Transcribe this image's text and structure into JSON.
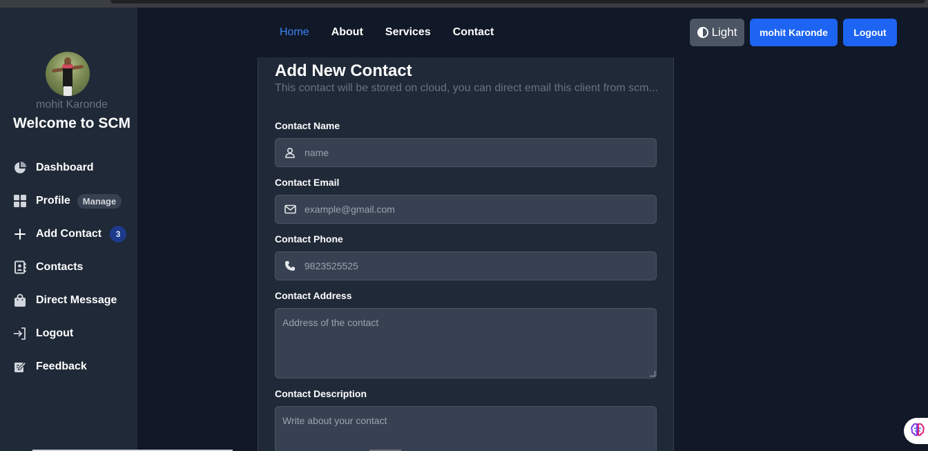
{
  "sidebar": {
    "username": "mohit Karonde",
    "welcome": "Welcome to SCM",
    "items": [
      {
        "label": "Dashboard",
        "icon": "pie-chart-icon"
      },
      {
        "label": "Profile",
        "icon": "grid-icon",
        "badge": "Manage"
      },
      {
        "label": "Add Contact",
        "icon": "plus-icon",
        "badge": "3"
      },
      {
        "label": "Contacts",
        "icon": "contact-book-icon"
      },
      {
        "label": "Direct Message",
        "icon": "shopping-bag-icon"
      },
      {
        "label": "Logout",
        "icon": "logout-icon"
      },
      {
        "label": "Feedback",
        "icon": "edit-icon"
      }
    ]
  },
  "topnav": {
    "links": [
      "Home",
      "About",
      "Services",
      "Contact"
    ],
    "active": "Home",
    "theme_label": "Light",
    "user_button": "mohit Karonde",
    "logout_button": "Logout"
  },
  "form": {
    "title": "Add New Contact",
    "subtitle": "This contact will be stored on cloud, you can direct email this client from scm...",
    "name_label": "Contact Name",
    "name_placeholder": "name",
    "email_label": "Contact Email",
    "email_placeholder": "example@gmail.com",
    "phone_label": "Contact Phone",
    "phone_placeholder": "9823525525",
    "address_label": "Contact Address",
    "address_placeholder": "Address of the contact",
    "description_label": "Contact Description",
    "description_placeholder": "Write about your contact"
  },
  "colors": {
    "accent": "#1d64f2",
    "active_link": "#3b82f6",
    "sidebar_bg": "#1f2937",
    "page_bg": "#111827"
  }
}
